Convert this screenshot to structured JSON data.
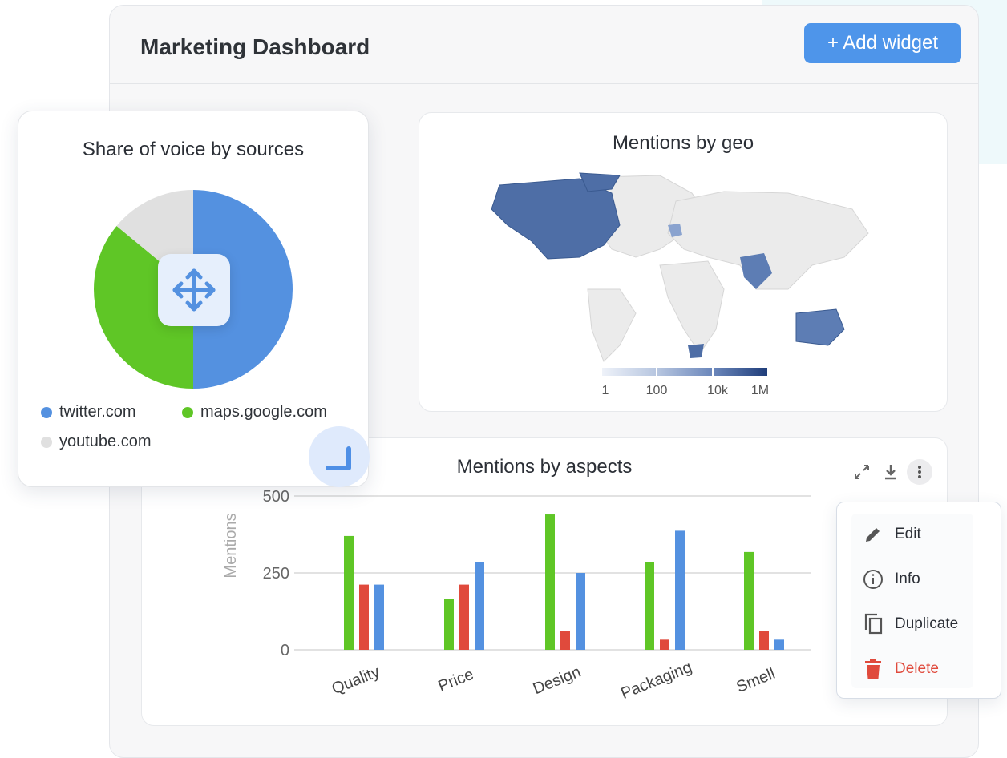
{
  "header": {
    "title": "Marketing Dashboard",
    "add_widget_label": "+ Add widget"
  },
  "share_of_voice": {
    "title": "Share of voice by sources",
    "legend": [
      {
        "label": "twitter.com",
        "color": "#5491e0"
      },
      {
        "label": "maps.google.com",
        "color": "#5fc626"
      },
      {
        "label": "youtube.com",
        "color": "#e0e0e0"
      }
    ],
    "slices": [
      {
        "label": "twitter.com",
        "value": 50,
        "color": "#5491e0"
      },
      {
        "label": "maps.google.com",
        "value": 36,
        "color": "#5fc626"
      },
      {
        "label": "youtube.com",
        "value": 14,
        "color": "#e0e0e0"
      }
    ],
    "move_icon": "move-arrows-icon",
    "resize_icon": "resize-corner-icon"
  },
  "geo": {
    "title": "Mentions by geo",
    "scale_labels": [
      "1",
      "100",
      "10k",
      "1M"
    ],
    "scale_colors": [
      "#e8eef8",
      "#9fb1d4",
      "#5573a8",
      "#1f3d7a"
    ]
  },
  "aspects": {
    "title": "Mentions by aspects",
    "toolbar": {
      "expand_icon": "expand-icon",
      "download_icon": "download-icon",
      "more_icon": "more-vertical-icon"
    }
  },
  "menu": {
    "items": [
      {
        "label": "Edit",
        "icon": "pencil-icon"
      },
      {
        "label": "Info",
        "icon": "info-icon"
      },
      {
        "label": "Duplicate",
        "icon": "duplicate-icon"
      },
      {
        "label": "Delete",
        "icon": "trash-icon",
        "color": "#e04a3c"
      }
    ]
  },
  "chart_data": [
    {
      "type": "pie",
      "title": "Share of voice by sources",
      "categories": [
        "twitter.com",
        "maps.google.com",
        "youtube.com"
      ],
      "values": [
        50,
        36,
        14
      ]
    },
    {
      "type": "bar",
      "title": "Mentions by aspects",
      "ylabel": "Mentions",
      "ylim": [
        0,
        500
      ],
      "yticks": [
        0,
        250,
        500
      ],
      "categories": [
        "Quality",
        "Price",
        "Design",
        "Packaging",
        "Smell"
      ],
      "series": [
        {
          "color": "#5fc626",
          "values": [
            370,
            165,
            440,
            285,
            318
          ]
        },
        {
          "color": "#e04a3c",
          "values": [
            212,
            212,
            60,
            33,
            60
          ]
        },
        {
          "color": "#5491e0",
          "values": [
            212,
            285,
            250,
            387,
            33
          ]
        }
      ],
      "grid": true
    }
  ]
}
